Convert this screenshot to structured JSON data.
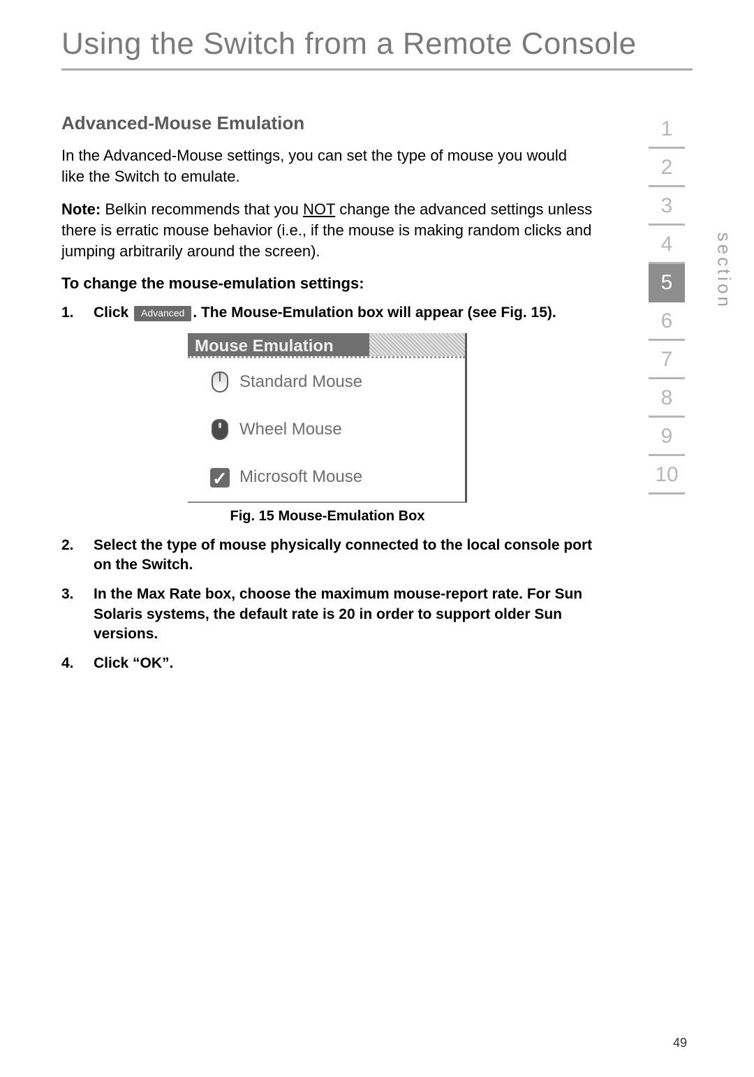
{
  "title": "Using the Switch from a Remote Console",
  "heading": "Advanced-Mouse Emulation",
  "intro": "In the Advanced-Mouse settings, you can set the type of mouse you would like the Switch to emulate.",
  "note_label": "Note:",
  "note_pre": " Belkin recommends that you ",
  "note_underline": "NOT",
  "note_post": " change the advanced settings unless there is erratic mouse behavior (i.e., if the mouse is making random clicks and jumping arbitrarily around the screen).",
  "subheading": "To change the mouse-emulation settings:",
  "steps": {
    "s1_pre": "Click ",
    "s1_btn": "Advanced",
    "s1_post": ". The Mouse-Emulation box will appear (see Fig. 15).",
    "s2": "Select the type of mouse physically connected to the local console port on the Switch.",
    "s3": "In the Max Rate box, choose the maximum mouse-report rate. For Sun Solaris systems, the default rate is 20 in order to support older Sun versions.",
    "s4": "Click “OK”."
  },
  "step_numbers": {
    "n1": "1.",
    "n2": "2.",
    "n3": "3.",
    "n4": "4."
  },
  "figure": {
    "titlebar": "Mouse Emulation",
    "options": {
      "standard": "Standard Mouse",
      "wheel": "Wheel Mouse",
      "microsoft": "Microsoft Mouse"
    },
    "caption": "Fig. 15 Mouse-Emulation Box"
  },
  "sidenav": {
    "label": "section",
    "items": [
      "1",
      "2",
      "3",
      "4",
      "5",
      "6",
      "7",
      "8",
      "9",
      "10"
    ],
    "active_index": 4
  },
  "page_number": "49"
}
